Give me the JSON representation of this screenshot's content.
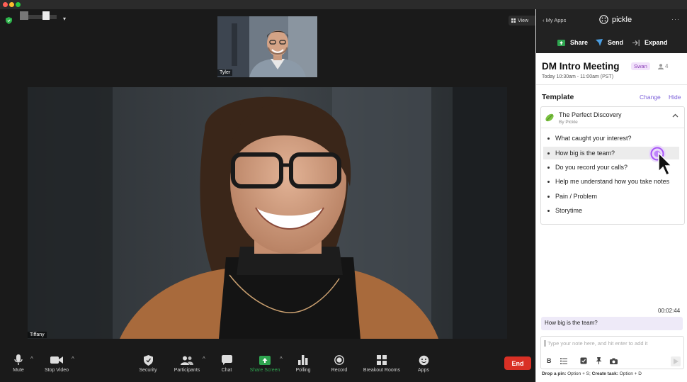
{
  "zoom": {
    "meeting_name": "",
    "view_label": "View",
    "thumbnail_name": "Tyler",
    "main_name": "Tiffany",
    "toolbar": [
      {
        "label": "Mute"
      },
      {
        "label": "Stop Video"
      },
      {
        "label": "Security"
      },
      {
        "label": "Participants"
      },
      {
        "label": "Chat"
      },
      {
        "label": "Share Screen"
      },
      {
        "label": "Polling"
      },
      {
        "label": "Record"
      },
      {
        "label": "Breakout Rooms"
      },
      {
        "label": "Apps"
      }
    ],
    "end_label": "End"
  },
  "panel": {
    "back_label": "My Apps",
    "app_name": "pickle",
    "share_label": "Share",
    "send_label": "Send",
    "expand_label": "Expand",
    "meeting_title": "DM Intro Meeting",
    "badge": "Swan",
    "participant_count": "4",
    "meeting_time": "Today 10:30am - 11:00am (PST)",
    "template_heading": "Template",
    "change_label": "Change",
    "hide_label": "Hide",
    "template_name": "The Perfect Discovery",
    "template_author": "By Pickle",
    "questions": [
      "What caught your interest?",
      "How big is the team?",
      "Do you record your calls?",
      "Help me understand how you take notes",
      "Pain / Problem",
      "Storytime"
    ],
    "timer": "00:02:44",
    "note": "How big is the team?",
    "input_placeholder": "Type your note here, and hit enter to add it",
    "hint_pin_label": "Drop a pin:",
    "hint_pin_keys": "Option + S;",
    "hint_task_label": "Create task:",
    "hint_task_keys": "Option + D"
  },
  "colors": {
    "accent": "#7b5fd9",
    "end": "#d93025",
    "share_green": "#2ea44f",
    "badge_bg": "#f2e3fb"
  }
}
